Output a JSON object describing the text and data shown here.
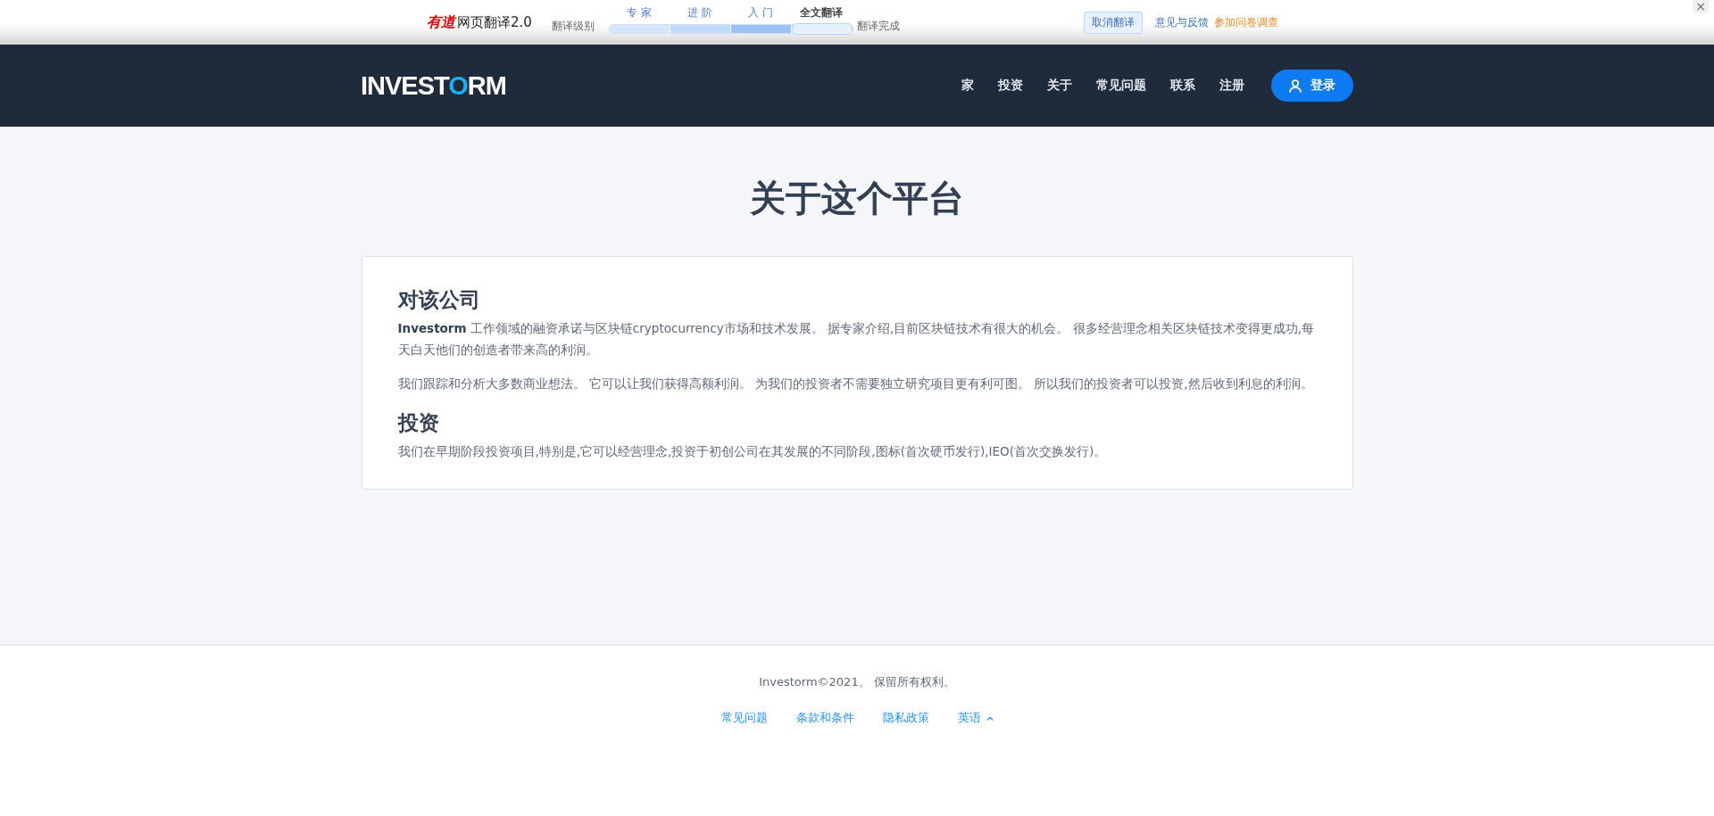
{
  "translate_bar": {
    "brand": "有道",
    "product": "网页翻译2.0",
    "level_label": "翻译级别",
    "levels": [
      {
        "label": "专 家",
        "selected": false
      },
      {
        "label": "进 阶",
        "selected": false
      },
      {
        "label": "入 门",
        "selected": false
      },
      {
        "label": "全文翻译",
        "selected": true
      }
    ],
    "status": "翻译完成",
    "cancel_button": "取消翻译",
    "feedback_link": "意见与反馈",
    "survey_link": "参加问卷调查",
    "close": "×"
  },
  "header": {
    "logo": {
      "before": "INVEST",
      "accent": "O",
      "after": "RM"
    },
    "nav": [
      {
        "label": "家"
      },
      {
        "label": "投资"
      },
      {
        "label": "关于"
      },
      {
        "label": "常见问题"
      },
      {
        "label": "联系"
      },
      {
        "label": "注册"
      }
    ],
    "login_button": "登录"
  },
  "page_title": "关于这个平台",
  "sections": [
    {
      "heading": "对该公司",
      "paragraphs": [
        "**Investorm** 工作领域的融资承诺与区块链cryptocurrency市场和技术发展。 据专家介绍,目前区块链技术有很大的机会。 很多经营理念相关区块链技术变得更成功,每天白天他们的创造者带来高的利润。",
        "我们跟踪和分析大多数商业想法。 它可以让我们获得高额利润。 为我们的投资者不需要独立研究项目更有利可图。 所以我们的投资者可以投资,然后收到利息的利润。"
      ]
    },
    {
      "heading": "投资",
      "paragraphs": [
        "我们在早期阶段投资项目,特别是,它可以经营理念,投资于初创公司在其发展的不同阶段,图标(首次硬币发行),IEO(首次交换发行)。"
      ]
    }
  ],
  "footer": {
    "copyright": "Investorm©2021。 保留所有权利。",
    "links": [
      {
        "label": "常见问题"
      },
      {
        "label": "条款和条件"
      },
      {
        "label": "隐私政策"
      }
    ],
    "language": "英语"
  }
}
